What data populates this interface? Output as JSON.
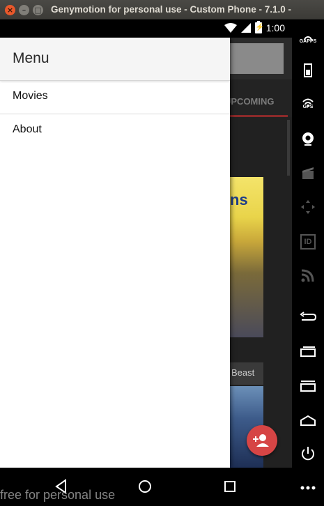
{
  "window": {
    "title": "Genymotion for personal use - Custom Phone - 7.1.0 -",
    "close": "×",
    "minimize": "–",
    "maximize": "□"
  },
  "status_bar": {
    "time": "1:00",
    "battery_glyph": "⚡"
  },
  "app": {
    "tab_label": "UPCOMING",
    "poster1_text": "ns",
    "caption": "Beast",
    "fab_icon": "add-person-icon"
  },
  "drawer": {
    "title": "Menu",
    "items": [
      {
        "label": "Movies"
      },
      {
        "label": "About"
      }
    ]
  },
  "watermark": "free for personal use",
  "sidebar": {
    "gapps_label": "GAPPS",
    "gps_label": "GPS",
    "id_label": "ID"
  },
  "colors": {
    "accent": "#d64545",
    "drawer_header": "#f5f5f5",
    "app_bg": "#212121"
  }
}
